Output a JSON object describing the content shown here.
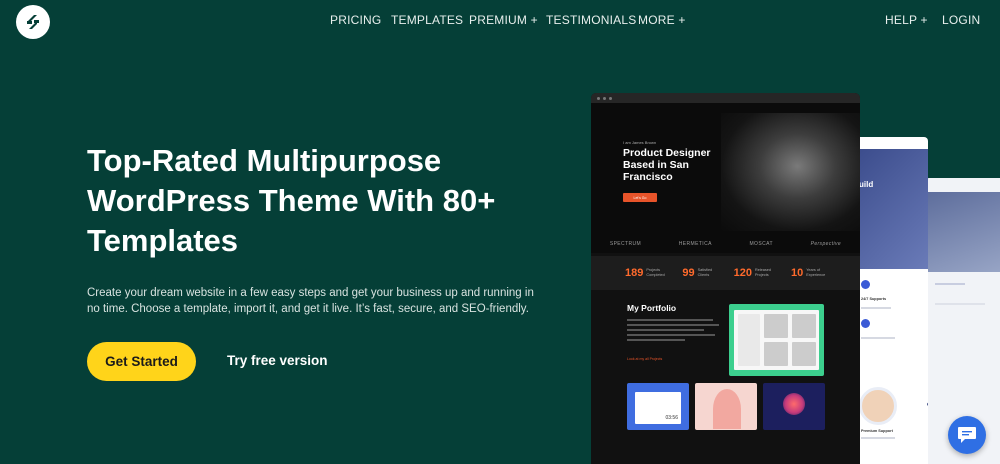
{
  "nav": {
    "items": [
      "PRICING",
      "TEMPLATES",
      "PREMIUM +",
      "TESTIMONIALS",
      "MORE +"
    ],
    "help": "HELP +",
    "login": "LOGIN"
  },
  "hero": {
    "title": "Top-Rated Multipurpose WordPress Theme With 80+ Templates",
    "subtitle": "Create your dream website in a few easy steps and get your business up and running in no time. Choose a template, import it, and get it live. It’s fast, secure, and SEO-friendly.",
    "primary_button": "Get Started",
    "secondary_link": "Try free version"
  },
  "mockup": {
    "eyebrow": "I am James Brown",
    "title": "Product Designer Based in San Francisco",
    "cta": "Let's Go",
    "logos": [
      "SPECTRUM",
      "HERMETICA",
      "MOSCAT",
      "Perspective"
    ],
    "stats": [
      {
        "value": "189",
        "label": "Projects Completed"
      },
      {
        "value": "99",
        "label": "Satisfied Clients"
      },
      {
        "value": "120",
        "label": "Released Projects"
      },
      {
        "value": "10",
        "label": "Years of Experience"
      }
    ],
    "portfolio_title": "My Portfolio",
    "portfolio_link": "Look at my all Projects",
    "calendar_time": "03:56"
  },
  "back_mock": {
    "heading": "uild",
    "support": "24/7 Supports",
    "feature": "our",
    "premium": "Premium Support"
  },
  "colors": {
    "background": "#053f37",
    "accent": "#ffd41a",
    "mock_accent": "#ff6a2c",
    "chat": "#2f6fe4"
  },
  "icons": {
    "logo": "z-logo-icon",
    "chat": "chat-bubble-icon"
  }
}
